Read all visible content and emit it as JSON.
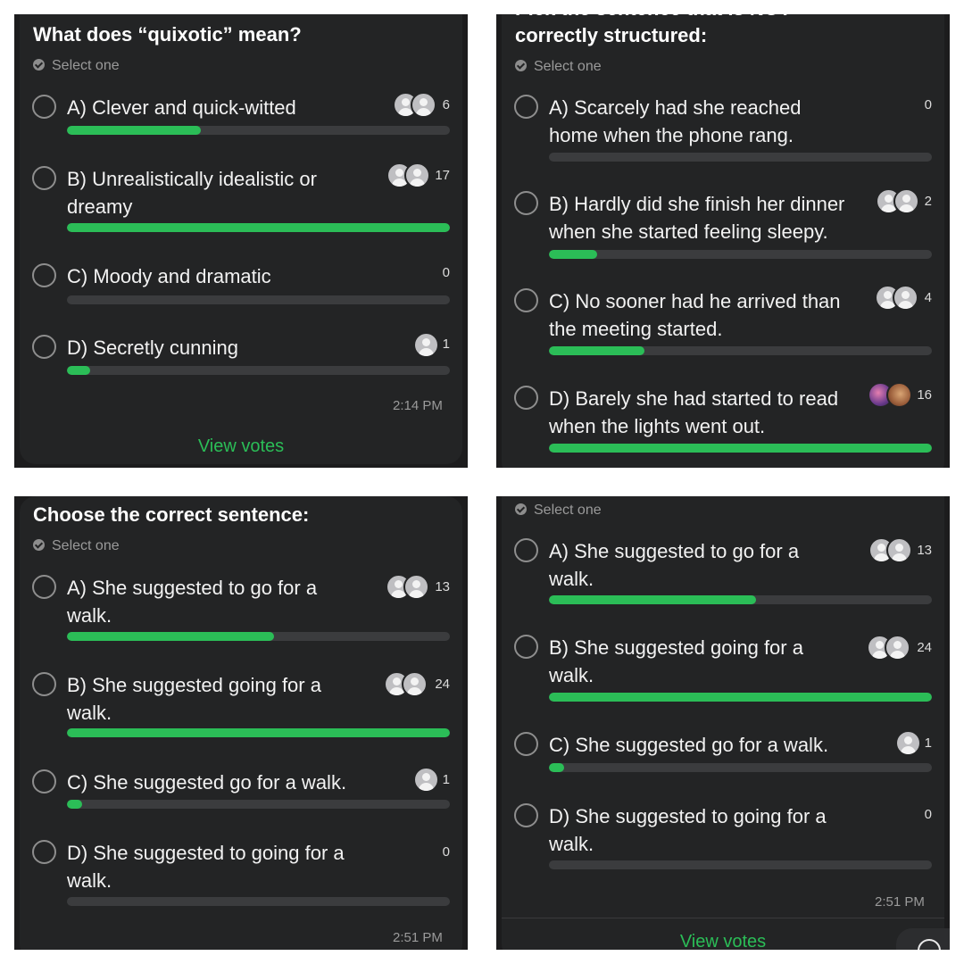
{
  "panels": [
    {
      "title": "What does “quixotic” mean?",
      "select_label": "Select one",
      "options": [
        {
          "text": "A) Clever and quick-witted",
          "count": "6",
          "fraction": 0.35
        },
        {
          "text": "B) Unrealistically idealistic or dreamy",
          "count": "17",
          "fraction": 1.0
        },
        {
          "text": "C) Moody and dramatic",
          "count": "0",
          "fraction": 0
        },
        {
          "text": "D) Secretly cunning",
          "count": "1",
          "fraction": 0.06
        }
      ],
      "time": "2:14 PM",
      "view_votes": "View votes"
    },
    {
      "title_partial": "Pick the sentence that is NOT",
      "title": "correctly structured:",
      "select_label": "Select one",
      "options": [
        {
          "text": "A) Scarcely had she reached home when the phone rang.",
          "count": "0",
          "fraction": 0
        },
        {
          "text": "B) Hardly did she finish her dinner when she started feeling sleepy.",
          "count": "2",
          "fraction": 0.125
        },
        {
          "text": "C) No sooner had he arrived than the meeting started.",
          "count": "4",
          "fraction": 0.25
        },
        {
          "text": "D) Barely she had started to read when the lights went out.",
          "count": "16",
          "fraction": 1.0
        }
      ]
    },
    {
      "title": "Choose the correct sentence:",
      "select_label": "Select one",
      "options": [
        {
          "text": "A) She suggested to go for a walk.",
          "count": "13",
          "fraction": 0.54
        },
        {
          "text": "B) She suggested going for a walk.",
          "count": "24",
          "fraction": 1.0
        },
        {
          "text": "C) She suggested go for a walk.",
          "count": "1",
          "fraction": 0.04
        },
        {
          "text": "D) She suggested to going for a walk.",
          "count": "0",
          "fraction": 0
        }
      ],
      "time": "2:51 PM"
    },
    {
      "select_label": "Select one",
      "options": [
        {
          "text": "A) She suggested to go for a walk.",
          "count": "13",
          "fraction": 0.54
        },
        {
          "text": "B) She suggested going for a walk.",
          "count": "24",
          "fraction": 1.0
        },
        {
          "text": "C) She suggested go for a walk.",
          "count": "1",
          "fraction": 0.04
        },
        {
          "text": "D) She suggested to going for a walk.",
          "count": "0",
          "fraction": 0
        }
      ],
      "time": "2:51 PM",
      "view_votes": "View votes"
    }
  ],
  "colors": {
    "accent": "#2bbd57",
    "track": "#3b3c3e",
    "card": "#232425",
    "text": "#f2f2f2",
    "muted": "#9a9a9a"
  }
}
